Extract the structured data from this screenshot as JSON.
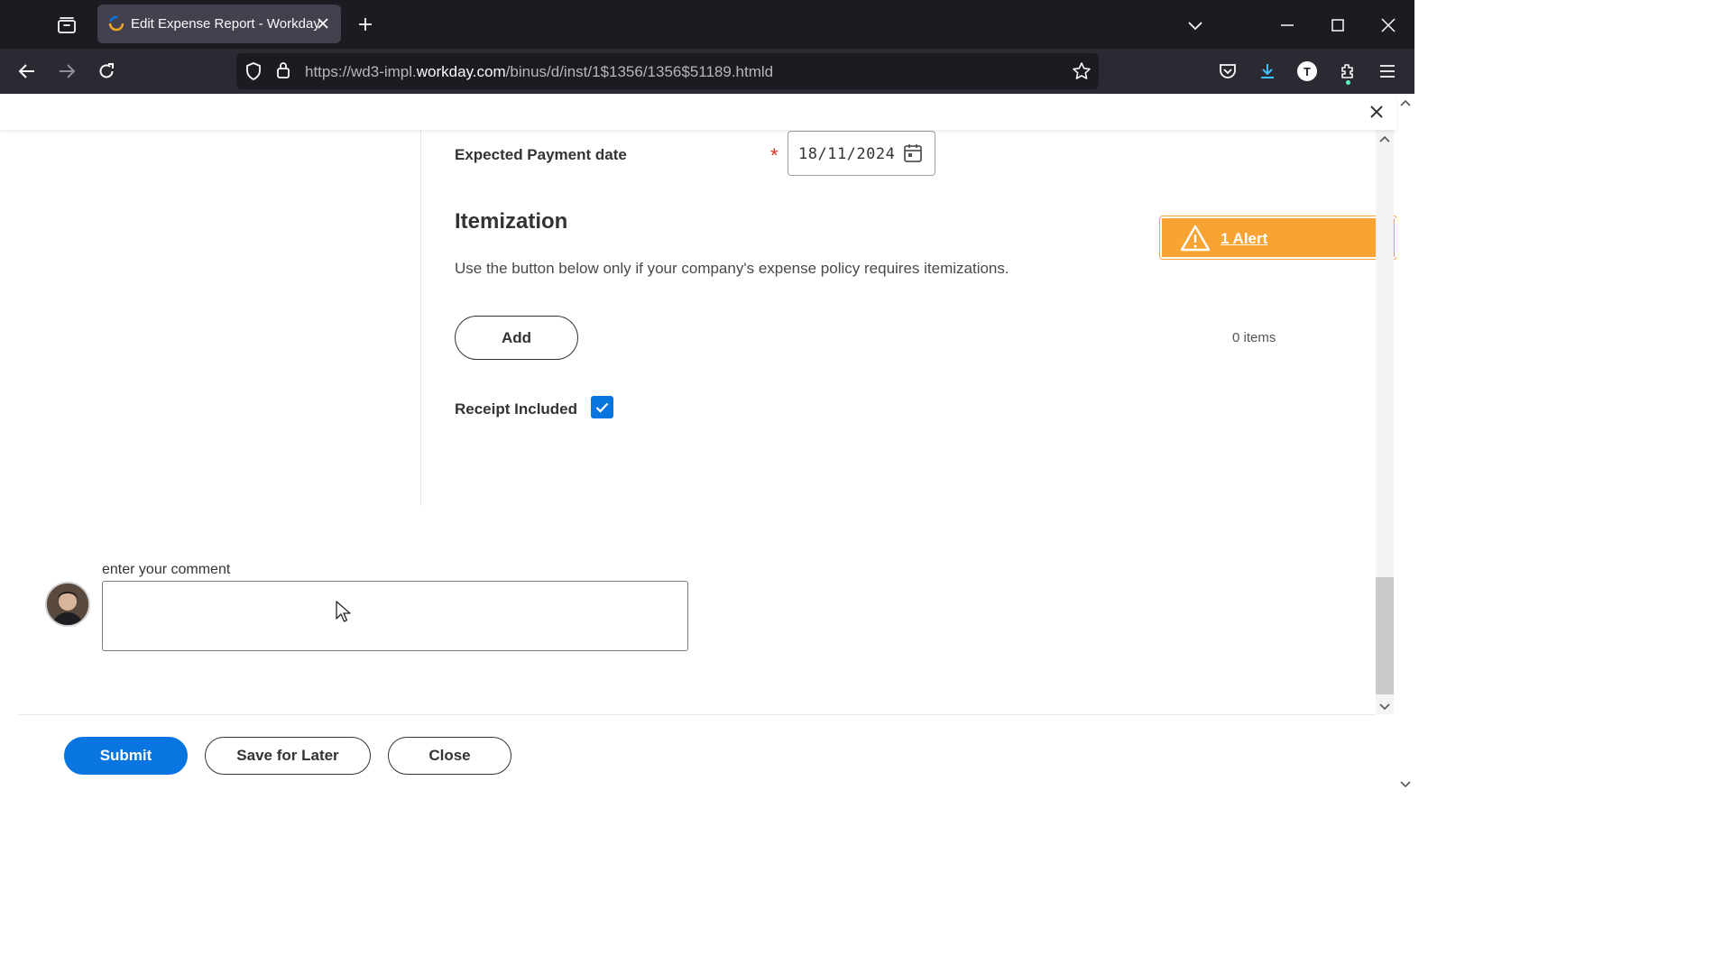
{
  "browser": {
    "tab_title": "Edit Expense Report - Workday",
    "url_prefix": "https://wd3-impl.",
    "url_domain": "workday.com",
    "url_path": "/binus/d/inst/1$1356/1356$51189.htmld",
    "profile_initial": "T"
  },
  "form": {
    "expected_payment_label": "Expected Payment date",
    "required_marker": "*",
    "expected_payment_value": "18/11/2024",
    "itemization_title": "Itemization",
    "itemization_desc": "Use the button below only if your company's expense policy requires itemizations.",
    "add_label": "Add",
    "items_count": "0 items",
    "receipt_label": "Receipt Included",
    "receipt_checked": true
  },
  "alert": {
    "text": "1 Alert",
    "color": "#f9a333"
  },
  "comment": {
    "label": "enter your comment",
    "value": ""
  },
  "footer": {
    "submit_label": "Submit",
    "save_label": "Save for Later",
    "close_label": "Close"
  },
  "colors": {
    "primary": "#0875e1",
    "required": "#de2e21",
    "chrome_dark": "#1c1b22"
  }
}
